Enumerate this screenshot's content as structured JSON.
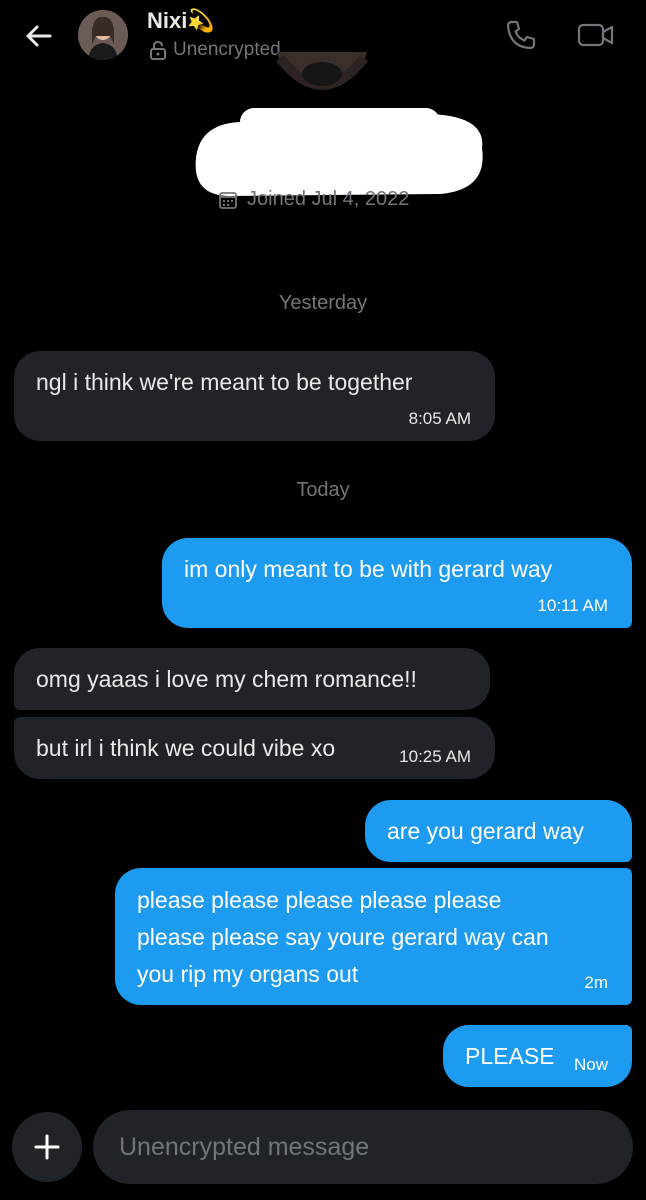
{
  "header": {
    "contact_name": "Nixi",
    "contact_emoji": "💫",
    "encryption_status": "Unencrypted"
  },
  "profile": {
    "joined_text": "Joined Jul 4, 2022"
  },
  "day_labels": {
    "yesterday": "Yesterday",
    "today": "Today"
  },
  "messages": [
    {
      "direction": "in",
      "text": "ngl i think we're meant to be together",
      "time": "8:05 AM"
    },
    {
      "direction": "out",
      "text": "im only meant to be with gerard way",
      "time": "10:11 AM"
    },
    {
      "direction": "in",
      "text": "omg yaaas i love my chem romance!!",
      "time": ""
    },
    {
      "direction": "in",
      "text": "but irl i think we could vibe xo",
      "time": "10:25 AM"
    },
    {
      "direction": "out",
      "text": "are you gerard way",
      "time": ""
    },
    {
      "direction": "out",
      "lines": [
        "please please please please please",
        "please please say youre gerard way can",
        "you rip my organs out"
      ],
      "time": "2m"
    },
    {
      "direction": "out",
      "text": "PLEASE",
      "time": "Now"
    }
  ],
  "composer": {
    "placeholder": "Unencrypted message"
  },
  "colors": {
    "background": "#000000",
    "incoming_bubble": "#202327",
    "outgoing_bubble": "#1d9bf0",
    "muted_text": "#71767b"
  }
}
